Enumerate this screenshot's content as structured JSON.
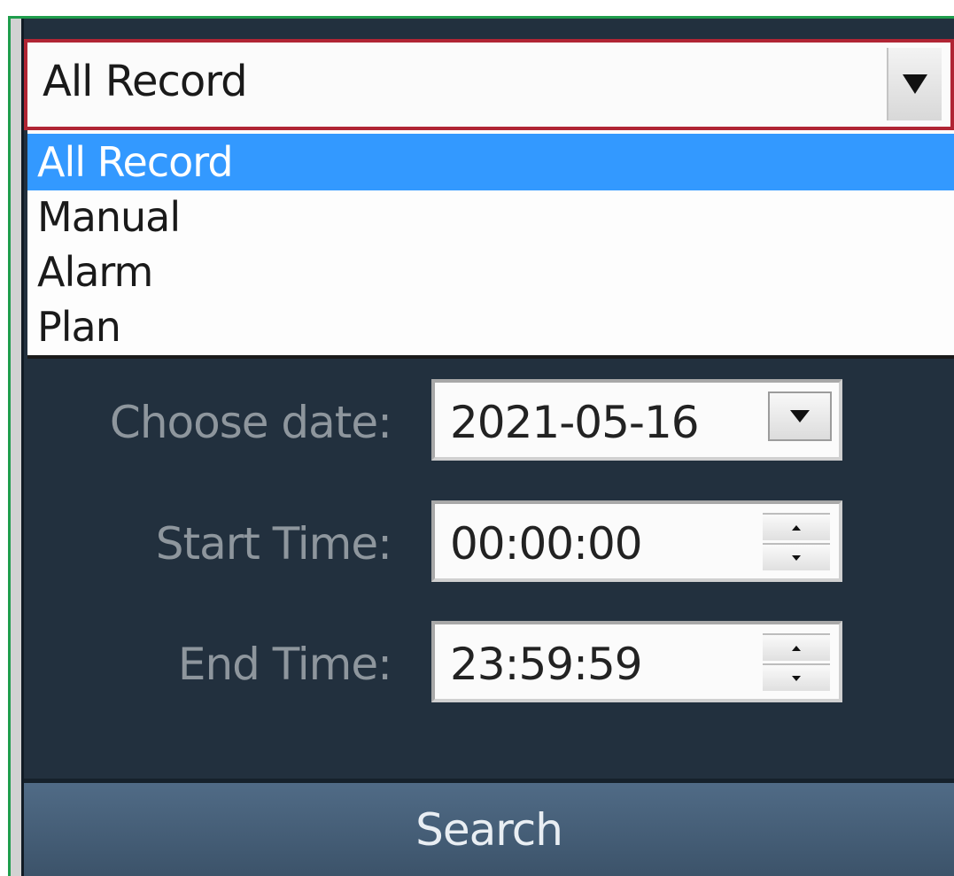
{
  "record_type": {
    "selected": "All Record",
    "options": [
      "All Record",
      "Manual",
      "Alarm",
      "Plan"
    ],
    "open": true
  },
  "date": {
    "label": "Choose date:",
    "value": "2021-05-16"
  },
  "start_time": {
    "label": "Start Time:",
    "value": "00:00:00"
  },
  "end_time": {
    "label": "End Time:",
    "value": "23:59:59"
  },
  "search": {
    "label": "Search"
  },
  "colors": {
    "panel_bg": "#22303e",
    "selection": "#3399ff",
    "focus_border": "#b02534",
    "button_bg": "#506b86"
  }
}
